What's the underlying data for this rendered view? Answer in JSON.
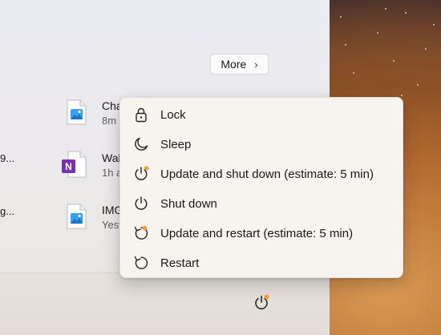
{
  "start_menu": {
    "more_button": {
      "label": "More",
      "chevron": "›"
    },
    "recommended": [
      {
        "name": "Cha",
        "sub": "8m",
        "icon": "image-file-icon"
      },
      {
        "name": "Wal",
        "sub": "1h a",
        "icon": "onenote-file-icon"
      },
      {
        "name": "IMG",
        "sub": "Yest",
        "icon": "image-file-icon"
      }
    ],
    "left_truncated": [
      "9...",
      "g..."
    ],
    "power_icon": "power-update-icon"
  },
  "power_menu": {
    "items": [
      {
        "label": "Lock",
        "icon": "lock-icon"
      },
      {
        "label": "Sleep",
        "icon": "moon-icon"
      },
      {
        "label": "Update and shut down (estimate: 5 min)",
        "icon": "power-update-icon"
      },
      {
        "label": "Shut down",
        "icon": "power-icon"
      },
      {
        "label": "Update and restart (estimate: 5 min)",
        "icon": "restart-update-icon"
      },
      {
        "label": "Restart",
        "icon": "restart-icon"
      }
    ]
  },
  "colors": {
    "update_badge": "#f0a030",
    "onenote_purple": "#7b2fb5",
    "image_icon_blue": "#2f8fe0"
  }
}
